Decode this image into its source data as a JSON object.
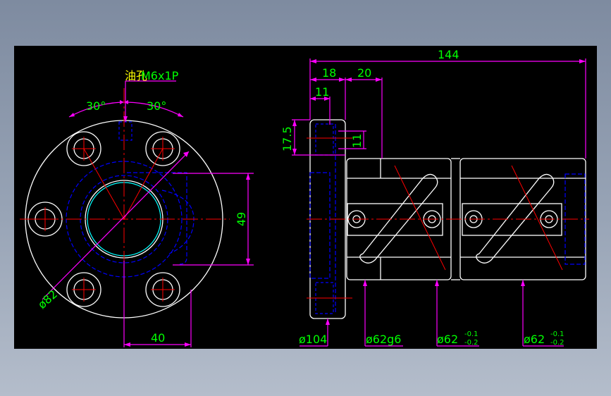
{
  "drawing": {
    "oil_hole_label": "油孔",
    "thread_label": "M6x1P",
    "angle_left": "30°",
    "angle_right": "30°",
    "dim_diameter_82": "ø82",
    "dim_49": "49",
    "dim_40": "40",
    "dim_144": "144",
    "dim_18": "18",
    "dim_20": "20",
    "dim_11_top": "11",
    "dim_17_5": "17.5",
    "dim_11_side": "11",
    "dim_phi_104": "ø104",
    "dim_phi_62g6": "ø62g6",
    "dim_phi_62_a": "ø62",
    "dim_phi_62_b": "ø62",
    "tol_upper": "-0.1",
    "tol_lower": "-0.2"
  },
  "colors": {
    "background": "#000000",
    "outline": "#ffffff",
    "dimension": "#ff00ff",
    "text": "#00ff00",
    "centerline": "#ff0000",
    "hidden": "#0000ff",
    "highlight": "#00ffff",
    "label": "#ffff00"
  }
}
